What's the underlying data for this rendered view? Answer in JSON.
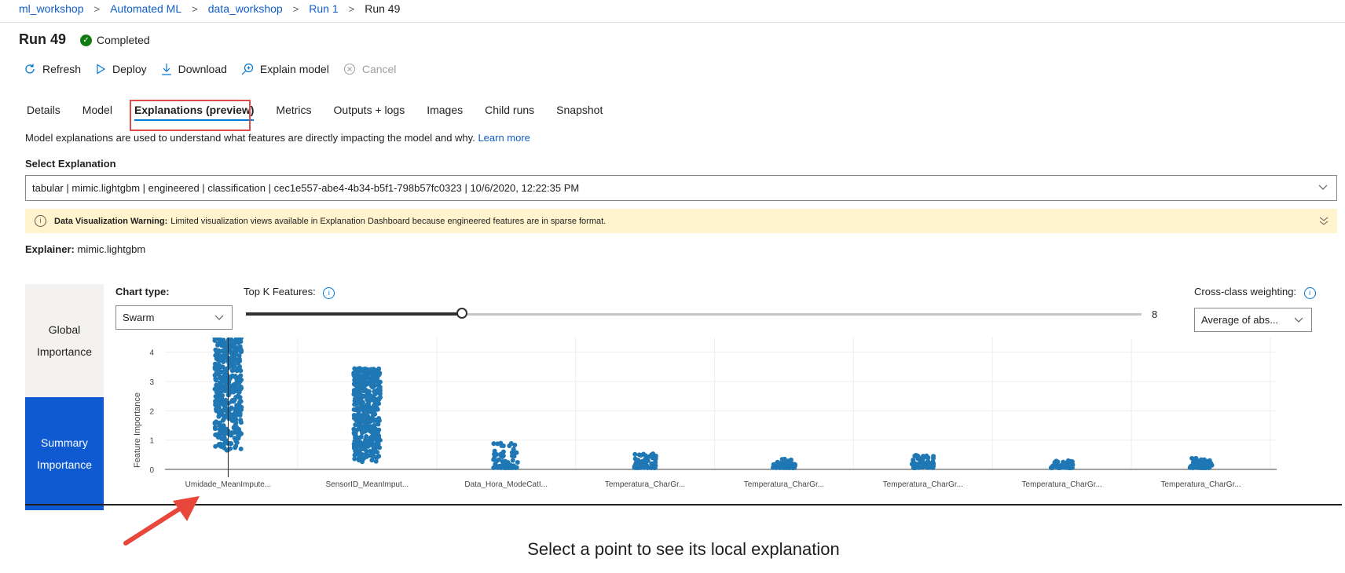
{
  "breadcrumb": [
    "ml_workshop",
    "Automated ML",
    "data_workshop",
    "Run 1",
    "Run 49"
  ],
  "page": {
    "title": "Run 49",
    "status": "Completed"
  },
  "toolbar": {
    "refresh": "Refresh",
    "deploy": "Deploy",
    "download": "Download",
    "explain": "Explain model",
    "cancel": "Cancel"
  },
  "tabs": [
    "Details",
    "Model",
    "Explanations (preview)",
    "Metrics",
    "Outputs + logs",
    "Images",
    "Child runs",
    "Snapshot"
  ],
  "selected_tab": "Explanations (preview)",
  "description": {
    "text": "Model explanations are used to understand what features are directly impacting the model and why.",
    "link": "Learn more"
  },
  "select_explanation": {
    "label": "Select Explanation",
    "value": "tabular | mimic.lightgbm | engineered | classification | cec1e557-abe4-4b34-b5f1-798b57fc0323 | 10/6/2020, 12:22:35 PM"
  },
  "warning": {
    "title": "Data Visualization Warning:",
    "text": "Limited visualization views available in Explanation Dashboard because engineered features are in sparse format."
  },
  "explainer": {
    "label": "Explainer:",
    "value": "mimic.lightgbm"
  },
  "side_nav": [
    {
      "line1": "Global",
      "line2": "Importance"
    },
    {
      "line1": "Summary",
      "line2": "Importance"
    }
  ],
  "controls": {
    "chart_type_label": "Chart type:",
    "chart_type_value": "Swarm",
    "topk_label": "Top K Features:",
    "topk_value": "8",
    "topk_fraction": 0.22,
    "weighting_label": "Cross-class weighting:",
    "weighting_value": "Average of abs..."
  },
  "chart_data": {
    "type": "scatter",
    "ylabel": "Feature Importance",
    "ylim": [
      0,
      4.5
    ],
    "yticks": [
      "0",
      "1",
      "2",
      "3",
      "4"
    ],
    "categories": [
      "Umidade_MeanImpute...",
      "SensorID_MeanImput...",
      "Data_Hora_ModeCatI...",
      "Temperatura_CharGr...",
      "Temperatura_CharGr...",
      "Temperatura_CharGr...",
      "Temperatura_CharGr...",
      "Temperatura_CharGr..."
    ],
    "ranges": [
      [
        0.6,
        4.5
      ],
      [
        0.2,
        3.4
      ],
      [
        0,
        0.85
      ],
      [
        0,
        0.5
      ],
      [
        0,
        0.3
      ],
      [
        0,
        0.45
      ],
      [
        0,
        0.25
      ],
      [
        0,
        0.35
      ]
    ],
    "color": "#1f77b4"
  },
  "bottom_prompt": "Select a point to see its local explanation"
}
